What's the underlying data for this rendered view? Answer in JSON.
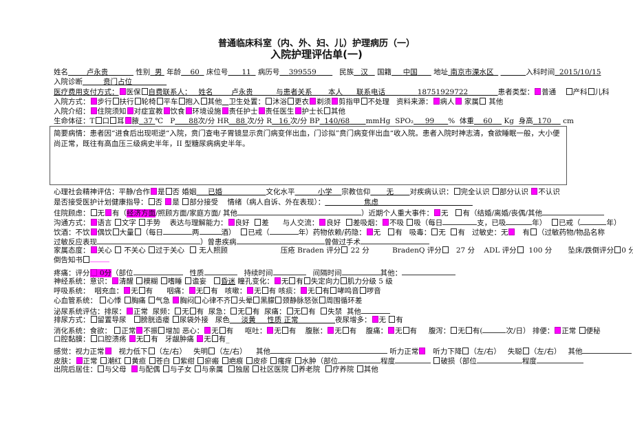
{
  "titles": {
    "main": "普通临床科室（内、外、妇、儿）护理病历（一）",
    "sub": "入院护理评估单(一)"
  },
  "patient": {
    "name_label": "姓名",
    "name": "卢永贵",
    "sex_label": "性别",
    "sex": "男",
    "age_label": "年龄",
    "age": "60",
    "bed_label": "床位号",
    "bed": "11",
    "record_label": "病历号",
    "record": "399559",
    "ethnic_label": "民族",
    "ethnic": "汉",
    "nation_label": "国籍",
    "nation": "中国",
    "address_label": "地址",
    "address": "南京市溧水区",
    "admit_time_label": "入科时间",
    "admit_time": "2015/10/15",
    "diagnosis_label": "入院诊断",
    "diagnosis": "贲门占位"
  },
  "payment": {
    "label": "医疗费用支付方式：",
    "opt1": "医保",
    "opt2": "自费",
    "contact_label": "联系人：",
    "contact_name_label": "姓名",
    "contact_name": "卢永贵",
    "relation_label": "与患者关系",
    "relation": "本人",
    "phone_label": "联系电话",
    "phone": "18751929722",
    "type_label": "患者类型：",
    "type_opts": [
      "普通",
      "产科",
      "儿科"
    ]
  },
  "admission_mode": {
    "label": "入院方式：",
    "opts": [
      "步行",
      "扶行",
      "轮椅",
      "平车",
      "抱入",
      "其他"
    ],
    "hygiene_label": "卫生处置：",
    "hygiene_opts": [
      "沐浴",
      "更衣",
      "剃须",
      "剪指甲",
      "不处理"
    ],
    "source_label": "资料来源：",
    "source_opts": [
      "病人",
      "家属",
      "其他"
    ]
  },
  "intro": {
    "label": "入院介绍：",
    "opts": [
      "住院须知",
      "对症宣教",
      "饮食",
      "环境设施",
      "责任护士",
      "责任医生",
      "护士长",
      "其他"
    ]
  },
  "vitals": {
    "label": "生命体征：T",
    "opts": [
      "口",
      "耳",
      "腋"
    ],
    "temp": "37",
    "temp_unit": "℃",
    "p_label": "P",
    "p": "88",
    "p_unit": "次/分",
    "hr_label": "HR",
    "hr": "88",
    "hr_unit": "次/分",
    "r_label": "R",
    "r": "16",
    "r_unit": "次/分",
    "bp_label": "BP",
    "bp": "140/68",
    "bp_unit": "mmHg",
    "spo2_label": "SPO₂",
    "spo2": "99",
    "spo2_unit": "%",
    "weight_label": "体重",
    "weight": "60",
    "weight_unit": "Kg",
    "height_label": "身高",
    "height": "170",
    "height_unit": "cm"
  },
  "history": {
    "text": "简要病情：患者因“进食后出现呃逆“入院，贲门查电子胃镜显示贲门病变伴出血，门诊拟”贲门病变伴出血“收入院。患者入院时神志清，食欲睡眠一般，大小便尚正常，既往有高血压三级病史半年，II 型糖尿病病史半年。"
  },
  "psych": {
    "label": "心理社会精神评估：平静/合作",
    "yes": "是",
    "no": "否",
    "marriage_label": "婚姻",
    "marriage": "已婚",
    "edu_label": "文化水平",
    "edu": "小学",
    "religion_label": "宗教信仰",
    "religion": "无",
    "awareness_label": "对疾病认识：",
    "awareness_opts": [
      "完全认识",
      "部分认识",
      "不认识"
    ]
  },
  "guidance": {
    "label": "是否接受医护计划健康指导：",
    "opts": [
      "否",
      "是",
      "部分接受"
    ],
    "mood_label": "情绪（病人自诉、外在表现）：",
    "mood": "焦虑"
  },
  "concern": {
    "label": "住院顾虑：",
    "opts": [
      "无",
      "有"
    ],
    "detail": "经济方面",
    "rest": "/照顾方面/家庭方面/ 其他",
    "event_label": "）近期个人重大事件：",
    "event_opts": [
      "无",
      "有（结婚/离婚/丧偶/其他"
    ]
  },
  "communication": {
    "label": "沟通方式：",
    "opts": [
      "语言",
      "文字",
      "手势"
    ],
    "express_label": "表达与理解能力：",
    "express_opts": [
      "良好",
      "差"
    ],
    "social_label": "与人交流：",
    "social_opts": [
      "良好",
      "差"
    ],
    "smoke_label": "吸烟：",
    "smoke_opts": [
      "不吸",
      "吸（每日",
      "支，已吸",
      "年）",
      "已戒（",
      "年）"
    ]
  },
  "drinking": {
    "label": "饮酒：不饮",
    "opts": [
      "偶饮",
      "大量"
    ],
    "daily": "（每日",
    "liang": "两",
    "jiu": "酒）",
    "quit": "已戒（",
    "year": "年）",
    "drug_label": "药物依赖/药隐：",
    "drug_opts": [
      "无",
      "有"
    ],
    "narcotic_label": "吸毒：",
    "narcotic_opts": [
      "无",
      "有"
    ],
    "allergy_label": "过敏史：无",
    "allergy_yes": "有",
    "allergy_detail": "（过敏药物/物品名称"
  },
  "allergy_reaction": {
    "label": "过敏反应表现",
    "disease_label": "）曾患疾病",
    "surgery_label": "曾做过手术"
  },
  "family": {
    "label": "家属态度：",
    "opts": [
      "关心",
      "不关心",
      "过于关心",
      "无人照顾"
    ],
    "braden_label": "压疮 Braden 评分",
    "braden": "22 分",
    "bradenq_label": "BradenQ 评分",
    "bradenq": "27 分",
    "adl_label": "ADL 评分",
    "adl": "100 分",
    "fall_label": "坠床/跌倒评分",
    "fall": "0 分",
    "fall_notice": "坠床/跌倒告知书"
  },
  "pain": {
    "label": "疼痛：评分",
    "score": "0分",
    "site_label": "（部位",
    "nature_label": "性质",
    "duration_label": "持续时间",
    "interval_label": "间隔时间",
    "other_label": "其他："
  },
  "neuro": {
    "label": "神经系统：意识：",
    "opts": [
      "清醒",
      "模糊",
      "嗜睡",
      "谵妄",
      "昏迷"
    ],
    "pupil_label": "瞳孔变化：",
    "pupil_opts": [
      "无",
      "有",
      "失定向力",
      "肌力分级 5 级"
    ]
  },
  "resp": {
    "label": "呼吸系统：",
    "throat_label": "咽充血：",
    "pain_label": "咽痛：",
    "cough_label": "咳嗽：",
    "sputum_label": "咳痰：",
    "yn": [
      "无",
      "有"
    ],
    "extra": [
      "哮鸣音",
      "啰音"
    ]
  },
  "cardio": {
    "label": "心血管系统：",
    "opts": [
      "心悸",
      "胸痛",
      "气急",
      "胸闷",
      "心律不齐",
      "头晕",
      "黑朦",
      "颈静脉怒张",
      "周围循环差"
    ]
  },
  "urinary": {
    "label": "泌尿系统评估：排尿：",
    "normal": "正常",
    "freq_label": "尿频：",
    "urgent_label": "尿急：",
    "pain_label": "尿痛：",
    "yn": [
      "无",
      "有"
    ],
    "incont": "失禁",
    "other": "其他"
  },
  "urination": {
    "label": "排尿方式：",
    "opts": [
      "留置导尿",
      "膀胱造瘘",
      "尿袋外接"
    ],
    "color_label": "尿色",
    "color": "淡黄",
    "nature_label": "性质",
    "nature": "正常",
    "night_label": "夜尿增多：",
    "yn": [
      "无",
      "有"
    ]
  },
  "digest": {
    "label": "消化系统：食欲：",
    "appetite": [
      "正常",
      "不振",
      "增加"
    ],
    "nausea_label": "恶心：",
    "vomit_label": "呕吐：",
    "bloat_label": "腹胀：",
    "pain_label": "腹痛：",
    "diarrhea_label": "腹泻：",
    "diarrhea_unit": "次/日）",
    "stool_label": "排便：",
    "stool_opts": [
      "正常",
      "便秘"
    ],
    "yn": [
      "无",
      "有"
    ]
  },
  "oral": {
    "label": "口腔黏膜：",
    "ulcer": "口腔溃疡",
    "gum_label": "牙龈肿痛",
    "yn": [
      "无",
      "有"
    ]
  },
  "senses": {
    "label": "感觉：",
    "vision_normal": "视力正常",
    "vision_low": "视力低下",
    "lr": "（左/右）",
    "blind": "失明",
    "other": "其他",
    "hear_normal": "听力正常",
    "hear_low": "听力下降",
    "deaf": "失聪"
  },
  "skin": {
    "label": "皮肤：",
    "opts": [
      "正常",
      "潮红",
      "黄疸",
      "苍白",
      "紫绀",
      "瘀瘢",
      "疤痕",
      "皮疹",
      "瘙痒",
      "水肿"
    ],
    "site": "（部位",
    "degree": "程度",
    "broken": "破损（部位"
  },
  "discharge": {
    "label": "出院后居住：",
    "opts": [
      "与父母",
      "与配偶",
      "与子女",
      "与亲属",
      "独居",
      "社区医院",
      "养老院",
      "疗养院",
      "其他"
    ]
  }
}
